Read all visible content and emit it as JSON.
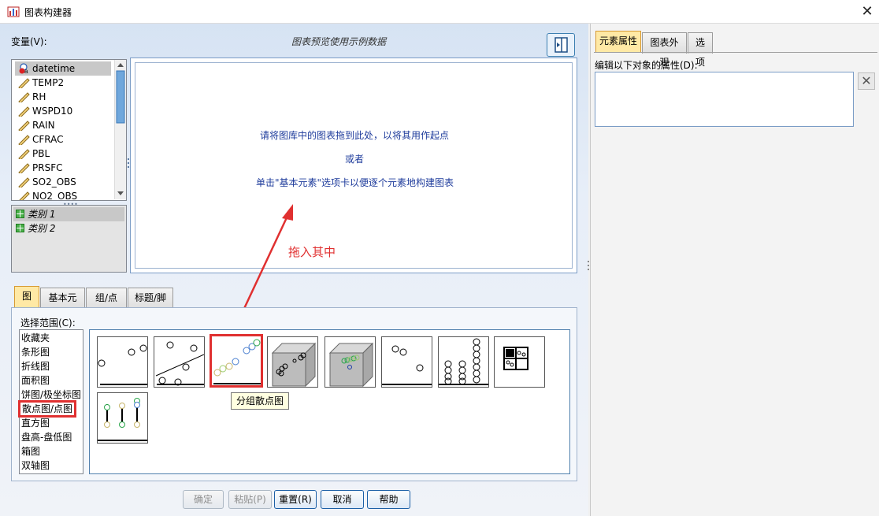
{
  "window": {
    "title": "图表构建器",
    "close_symbol": "✕"
  },
  "variables": {
    "label": "变量(V):",
    "items": [
      "datetime",
      "TEMP2",
      "RH",
      "WSPD10",
      "RAIN",
      "CFRAC",
      "PBL",
      "PRSFC",
      "SO2_OBS",
      "NO2_OBS"
    ],
    "categories": [
      "类别 1",
      "类别 2"
    ]
  },
  "preview": {
    "note": "图表预览使用示例数据",
    "instruction_1": "请将图库中的图表拖到此处，以将其用作起点",
    "instruction_or": "或者",
    "instruction_2": "单击\"基本元素\"选项卡以便逐个元素地构建图表"
  },
  "tabs": [
    "图库",
    "基本元素",
    "组/点 ID",
    "标题/脚注"
  ],
  "gallery": {
    "range_label": "选择范围(C):",
    "ranges": [
      "收藏夹",
      "条形图",
      "折线图",
      "面积图",
      "饼图/极坐标图",
      "散点图/点图",
      "直方图",
      "盘高-盘低图",
      "箱图",
      "双轴图"
    ],
    "selected_range": "散点图/点图",
    "tooltip": "分组散点图"
  },
  "annotation": {
    "text": "拖入其中",
    "color": "#e03030"
  },
  "buttons": {
    "ok": "确定",
    "paste": "粘贴(P)",
    "reset": "重置(R)",
    "cancel": "取消",
    "help": "帮助"
  },
  "right_panel": {
    "tabs": [
      "元素属性",
      "图表外观",
      "选项"
    ],
    "edit_label": "编辑以下对象的属性(D):",
    "remove_symbol": "✕"
  }
}
